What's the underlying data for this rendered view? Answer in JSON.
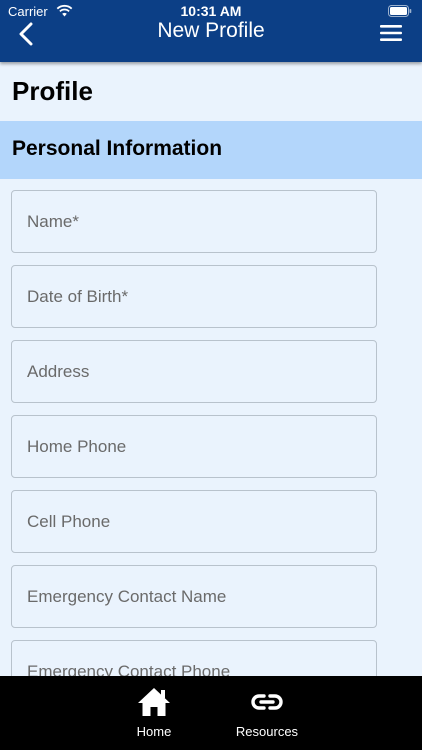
{
  "status_bar": {
    "carrier": "Carrier",
    "time": "10:31 AM",
    "wifi_icon": "wifi-icon",
    "battery_icon": "battery-icon"
  },
  "nav": {
    "title": "New Profile",
    "back_icon": "chevron-left-icon",
    "menu_icon": "hamburger-menu-icon",
    "background_color": "#0c3f86"
  },
  "page": {
    "title": "Profile"
  },
  "section": {
    "title": "Personal Information",
    "background_color": "#b3d6fb"
  },
  "form": {
    "fields": [
      {
        "placeholder": "Name*",
        "value": ""
      },
      {
        "placeholder": "Date of Birth*",
        "value": ""
      },
      {
        "placeholder": "Address",
        "value": ""
      },
      {
        "placeholder": "Home Phone",
        "value": ""
      },
      {
        "placeholder": "Cell Phone",
        "value": ""
      },
      {
        "placeholder": "Emergency Contact Name",
        "value": ""
      },
      {
        "placeholder": "Emergency Contact Phone",
        "value": ""
      }
    ]
  },
  "tabbar": {
    "tabs": [
      {
        "label": "Home",
        "icon": "home-icon"
      },
      {
        "label": "Resources",
        "icon": "link-icon"
      }
    ]
  }
}
